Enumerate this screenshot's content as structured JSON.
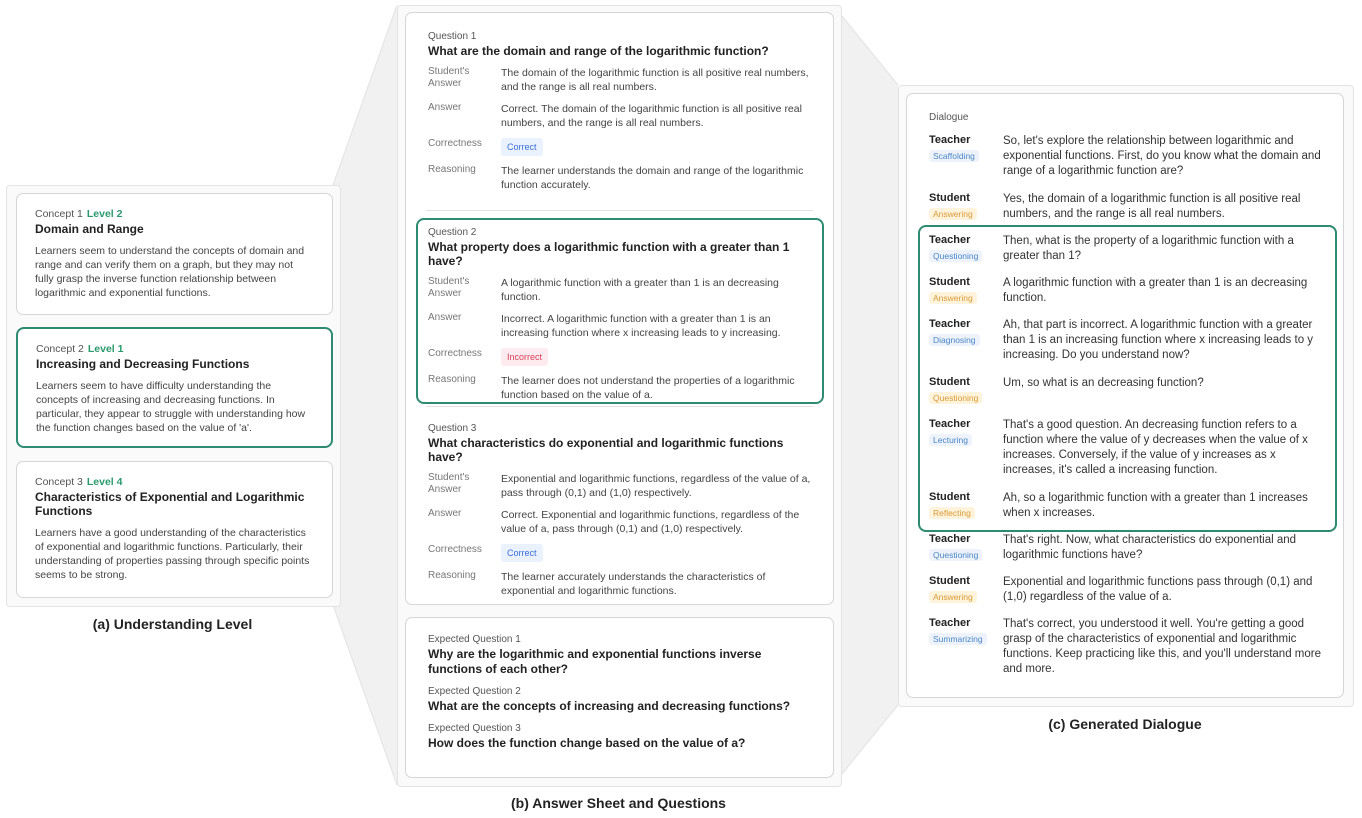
{
  "understanding": {
    "caption": "(a)  Understanding Level",
    "concepts": [
      {
        "label": "Concept 1",
        "level": "Level 2",
        "title": "Domain and Range",
        "desc": "Learners seem to understand the concepts of domain and range and can verify them on a graph, but they may not fully grasp the inverse function relationship between logarithmic and exponential functions."
      },
      {
        "label": "Concept 2",
        "level": "Level 1",
        "title": "Increasing and Decreasing Functions",
        "desc": "Learners seem to have difficulty understanding the concepts of increasing and decreasing functions. In particular, they appear to struggle with understanding how the function changes based on the value of 'a'."
      },
      {
        "label": "Concept 3",
        "level": "Level 4",
        "title": "Characteristics of Exponential and Logarithmic Functions",
        "desc": "Learners have a good understanding of the characteristics of exponential and logarithmic functions. Particularly, their understanding of properties passing through specific points seems to be strong."
      }
    ]
  },
  "answer_sheet": {
    "caption": "(b)  Answer Sheet and Questions",
    "keys": {
      "student_answer": "Student's Answer",
      "answer": "Answer",
      "correctness": "Correctness",
      "reasoning": "Reasoning"
    },
    "questions": [
      {
        "label": "Question 1",
        "title": "What are the domain and range of the logarithmic function?",
        "student_answer": "The domain of the logarithmic function is all positive real numbers, and the range is all real numbers.",
        "answer": "Correct. The domain of the logarithmic function is all positive real numbers, and the range is all real numbers.",
        "correctness": "Correct",
        "reasoning": "The learner understands the domain and range of the logarithmic function accurately."
      },
      {
        "label": "Question 2",
        "title": "What property does a logarithmic function with a greater than 1 have?",
        "student_answer": "A logarithmic function with a greater than 1 is an decreasing function.",
        "answer": "Incorrect. A logarithmic function with a greater than 1 is an increasing function where x increasing leads to y increasing.",
        "correctness": "Incorrect",
        "reasoning": "The learner does not understand the properties of a logarithmic function based on the value of a."
      },
      {
        "label": "Question 3",
        "title": "What characteristics do exponential and logarithmic functions have?",
        "student_answer": "Exponential and logarithmic functions, regardless of the value of a, pass through (0,1) and (1,0) respectively.",
        "answer": "Correct. Exponential and logarithmic functions, regardless of the value of a, pass through (0,1) and (1,0) respectively.",
        "correctness": "Correct",
        "reasoning": "The learner accurately understands the characteristics of exponential and logarithmic functions."
      }
    ],
    "expected": [
      {
        "label": "Expected Question 1",
        "title": "Why are the logarithmic and exponential functions inverse functions of each other?"
      },
      {
        "label": "Expected Question 2",
        "title": "What are the concepts of increasing and decreasing functions?"
      },
      {
        "label": "Expected Question 3",
        "title": "How does the function change based on the value of a?"
      }
    ]
  },
  "dialogue": {
    "caption": "(c)  Generated Dialogue",
    "header": "Dialogue",
    "turns": [
      {
        "speaker": "Teacher",
        "tag": "Scaffolding",
        "text": "So, let's explore the relationship between logarithmic and exponential functions. First, do you know what the domain and range of a logarithmic function are?"
      },
      {
        "speaker": "Student",
        "tag": "Answering",
        "text": "Yes, the domain of a logarithmic function is all positive real numbers, and the range is all real numbers."
      },
      {
        "speaker": "Teacher",
        "tag": "Questioning",
        "text": "Then, what is the property of a logarithmic function with a greater than 1?"
      },
      {
        "speaker": "Student",
        "tag": "Answering",
        "text": "A logarithmic function with a greater than 1 is an decreasing function."
      },
      {
        "speaker": "Teacher",
        "tag": "Diagnosing",
        "text": "Ah, that part is incorrect. A logarithmic function with a greater than 1 is an increasing function where x increasing leads to y increasing. Do you understand now?"
      },
      {
        "speaker": "Student",
        "tag": "Questioning",
        "text": "Um, so what is an decreasing function?"
      },
      {
        "speaker": "Teacher",
        "tag": "Lecturing",
        "text": "That's a good question. An decreasing function refers to a function where the value of y decreases when the value of x increases. Conversely, if the value of y increases as x increases, it's called a increasing function."
      },
      {
        "speaker": "Student",
        "tag": "Reflecting",
        "text": "Ah, so a logarithmic function with a greater than 1 increases when x increases."
      },
      {
        "speaker": "Teacher",
        "tag": "Questioning",
        "text": "That's right. Now, what characteristics do exponential and logarithmic functions have?"
      },
      {
        "speaker": "Student",
        "tag": "Answering",
        "text": "Exponential and logarithmic functions pass through (0,1) and (1,0) regardless of the value of a."
      },
      {
        "speaker": "Teacher",
        "tag": "Summarizing",
        "text": "That's correct, you understood it well. You're getting a good grasp of the characteristics of exponential and logarithmic functions. Keep practicing like this, and you'll understand more and more."
      }
    ]
  }
}
